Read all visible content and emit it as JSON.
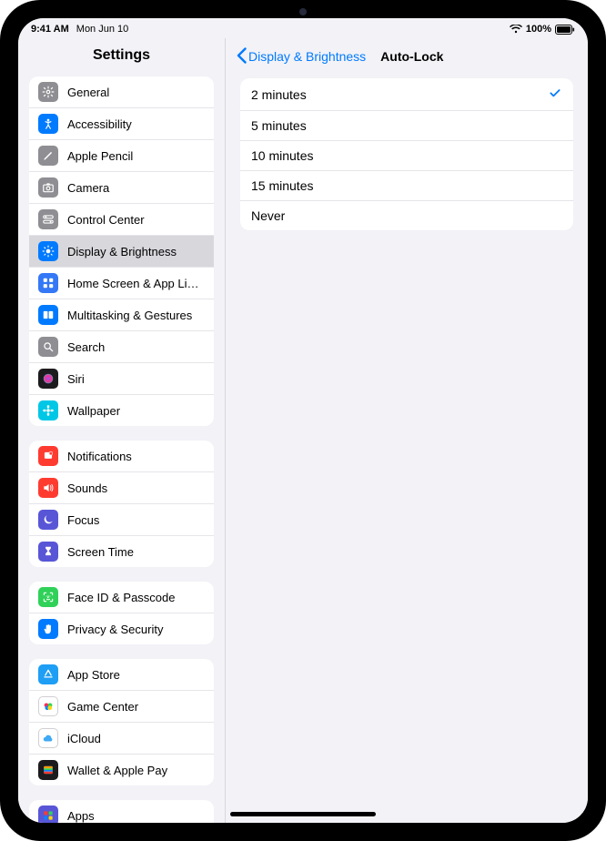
{
  "status": {
    "time": "9:41 AM",
    "date": "Mon Jun 10",
    "battery": "100%"
  },
  "sidebar": {
    "title": "Settings",
    "groups": [
      [
        {
          "label": "General",
          "icon": "gear",
          "bg": "#8e8e93"
        },
        {
          "label": "Accessibility",
          "icon": "figure",
          "bg": "#007aff"
        },
        {
          "label": "Apple Pencil",
          "icon": "pencil",
          "bg": "#8e8e93"
        },
        {
          "label": "Camera",
          "icon": "camera",
          "bg": "#8e8e93"
        },
        {
          "label": "Control Center",
          "icon": "switches",
          "bg": "#8e8e93"
        },
        {
          "label": "Display & Brightness",
          "icon": "sun",
          "bg": "#007aff",
          "selected": true
        },
        {
          "label": "Home Screen & App Library",
          "icon": "grid",
          "bg": "#3478f6"
        },
        {
          "label": "Multitasking & Gestures",
          "icon": "rects",
          "bg": "#007aff"
        },
        {
          "label": "Search",
          "icon": "search",
          "bg": "#8e8e93"
        },
        {
          "label": "Siri",
          "icon": "siri",
          "bg": "#1c1c1e"
        },
        {
          "label": "Wallpaper",
          "icon": "flower",
          "bg": "#00c7e6"
        }
      ],
      [
        {
          "label": "Notifications",
          "icon": "bell",
          "bg": "#ff3b30"
        },
        {
          "label": "Sounds",
          "icon": "speaker",
          "bg": "#ff3b30"
        },
        {
          "label": "Focus",
          "icon": "moon",
          "bg": "#5856d6"
        },
        {
          "label": "Screen Time",
          "icon": "hourglass",
          "bg": "#5856d6"
        }
      ],
      [
        {
          "label": "Face ID & Passcode",
          "icon": "faceid",
          "bg": "#30d158"
        },
        {
          "label": "Privacy & Security",
          "icon": "hand",
          "bg": "#007aff"
        }
      ],
      [
        {
          "label": "App Store",
          "icon": "appstore",
          "bg": "#1e9ef4"
        },
        {
          "label": "Game Center",
          "icon": "gamecenter",
          "bg": "#ffffff"
        },
        {
          "label": "iCloud",
          "icon": "cloud",
          "bg": "#ffffff"
        },
        {
          "label": "Wallet & Apple Pay",
          "icon": "wallet",
          "bg": "#1c1c1e"
        }
      ],
      [
        {
          "label": "Apps",
          "icon": "apps",
          "bg": "#5856d6"
        }
      ]
    ]
  },
  "detail": {
    "back_label": "Display & Brightness",
    "title": "Auto-Lock",
    "options": [
      {
        "label": "2 minutes",
        "selected": true
      },
      {
        "label": "5 minutes",
        "selected": false
      },
      {
        "label": "10 minutes",
        "selected": false
      },
      {
        "label": "15 minutes",
        "selected": false
      },
      {
        "label": "Never",
        "selected": false
      }
    ]
  }
}
